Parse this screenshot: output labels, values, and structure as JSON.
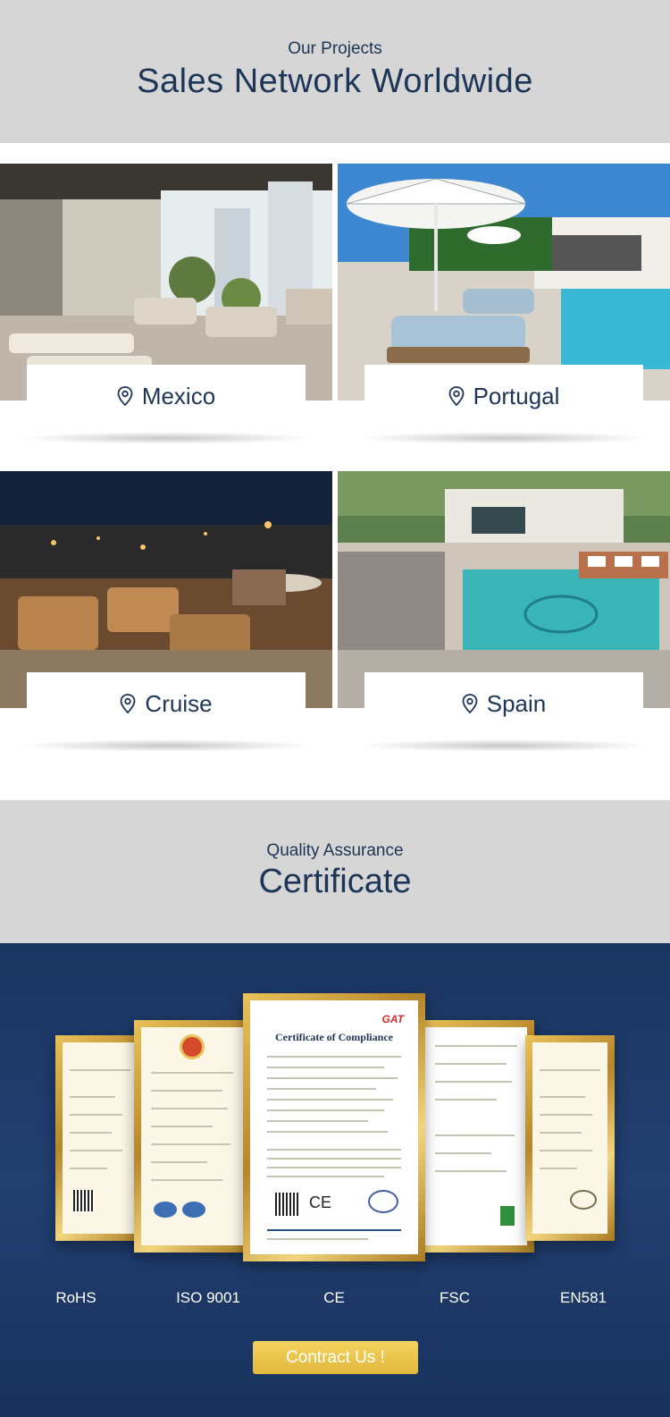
{
  "projects": {
    "eyebrow": "Our Projects",
    "title": "Sales Network Worldwide",
    "items": [
      {
        "label": "Mexico"
      },
      {
        "label": "Portugal"
      },
      {
        "label": "Cruise"
      },
      {
        "label": "Spain"
      }
    ]
  },
  "certificates": {
    "eyebrow": "Quality Assurance",
    "title": "Certificate",
    "featured_title": "Certificate of Compliance",
    "labels": [
      "RoHS",
      "ISO 9001",
      "CE",
      "FSC",
      "EN581"
    ],
    "contact_label": "Contract Us !"
  },
  "colors": {
    "brand_navy": "#1d3557",
    "header_bg": "#d6d6d6",
    "band_bg": "#1b3561",
    "button_gold": "#e9c44a"
  },
  "icons": {
    "location": "map-pin-icon"
  }
}
